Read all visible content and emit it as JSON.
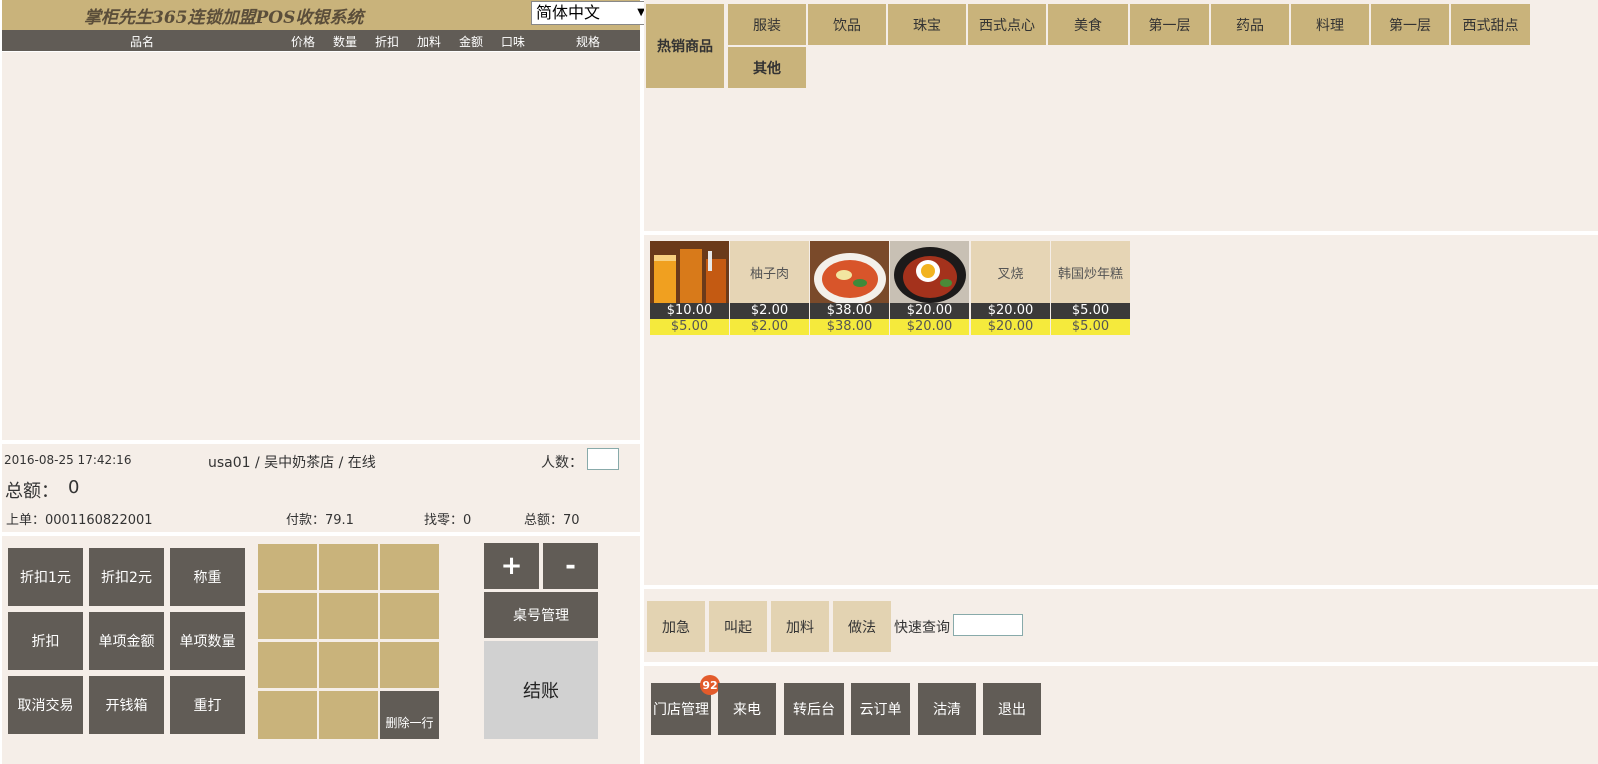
{
  "header": {
    "title": "掌柜先生365连锁加盟POS收银系统",
    "language": "简体中文"
  },
  "table_headers": [
    "品名",
    "价格",
    "数量",
    "折扣",
    "加料",
    "金额",
    "口味",
    "规格"
  ],
  "info": {
    "datetime": "2016-08-25 17:42:16",
    "user_store": "usa01 / 吴中奶茶店 / 在线",
    "people_label": "人数：",
    "total_label": "总额：",
    "total_value": "0",
    "last_order": "上单：0001160822001",
    "paid": "付款：79.1",
    "change": "找零：0",
    "sum": "总额：70"
  },
  "left_buttons": {
    "discount_1": "折扣1元",
    "discount_2": "折扣2元",
    "weigh": "称重",
    "discount": "折扣",
    "item_amount": "单项金额",
    "item_qty": "单项数量",
    "cancel_tx": "取消交易",
    "open_drawer": "开钱箱",
    "reprint": "重打",
    "delete_row": "删除一行",
    "plus": "+",
    "minus": "-",
    "table_mgmt": "桌号管理",
    "checkout": "结账"
  },
  "categories": {
    "hot": "热销商品",
    "list": [
      "服装",
      "饮品",
      "珠宝",
      "西式点心",
      "美食",
      "第一层",
      "药品",
      "料理",
      "第一层",
      "西式甜点"
    ],
    "other": "其他"
  },
  "products": [
    {
      "name": "",
      "image": "drinks-photo",
      "price": "$10.00",
      "member_price": "$5.00"
    },
    {
      "name": "柚子肉",
      "image": "",
      "price": "$2.00",
      "member_price": "$2.00"
    },
    {
      "name": "",
      "image": "noodle-soup-photo",
      "price": "$38.00",
      "member_price": "$38.00"
    },
    {
      "name": "",
      "image": "egg-rice-bowl-photo",
      "price": "$20.00",
      "member_price": "$20.00"
    },
    {
      "name": "叉烧",
      "image": "",
      "price": "$20.00",
      "member_price": "$20.00"
    },
    {
      "name": "韩国炒年糕",
      "image": "",
      "price": "$5.00",
      "member_price": "$5.00"
    }
  ],
  "ops": {
    "urgent": "加急",
    "call": "叫起",
    "add_on": "加料",
    "method": "做法",
    "quick_search": "快速查询"
  },
  "footer": {
    "store_mgmt": "门店管理",
    "store_badge": "92",
    "incoming_call": "来电",
    "backend": "转后台",
    "cloud_orders": "云订单",
    "sold_out": "沽清",
    "exit": "退出"
  },
  "colors": {
    "tan": "#c9b37b",
    "dark_gray": "#615c56",
    "panel_bg": "#f5eee8",
    "price_bar": "#3b3a39",
    "member_price_bar": "#f5ea3c",
    "badge": "#e35b2b"
  }
}
